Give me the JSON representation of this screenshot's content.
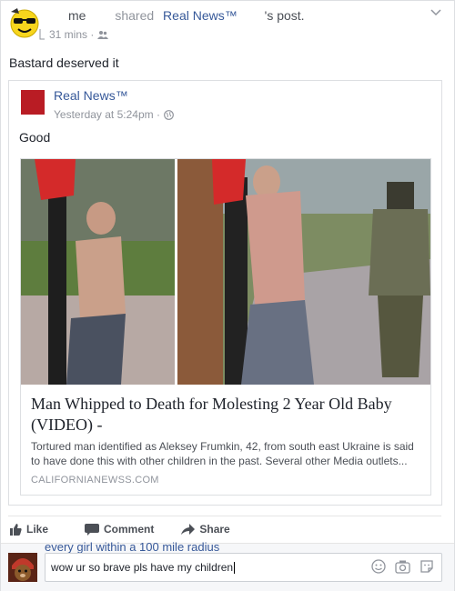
{
  "post": {
    "author": "me",
    "shared_word": "shared",
    "page_name": "Real News™",
    "post_tail": "'s post.",
    "time": "31 mins ·",
    "status": "Bastard deserved it"
  },
  "shared_post": {
    "page_name": "Real News™",
    "time": "Yesterday at 5:24pm ·",
    "text": "Good",
    "link": {
      "title": "Man Whipped to Death for Molesting 2 Year Old Baby (VIDEO) -",
      "description": "Tortured man identified as Aleksey Frumkin, 42, from south east Ukraine is said to have done this with other children in the past. Several other Media outlets...",
      "domain": "CALIFORNIANEWSS.COM"
    }
  },
  "actions": {
    "like": "Like",
    "comment": "Comment",
    "share": "Share"
  },
  "comment_box": {
    "overlay_text": "every girl within a 100 mile radius",
    "value": "wow ur so brave pls have my children"
  },
  "colors": {
    "link_blue": "#365899",
    "meta_gray": "#90949c"
  }
}
